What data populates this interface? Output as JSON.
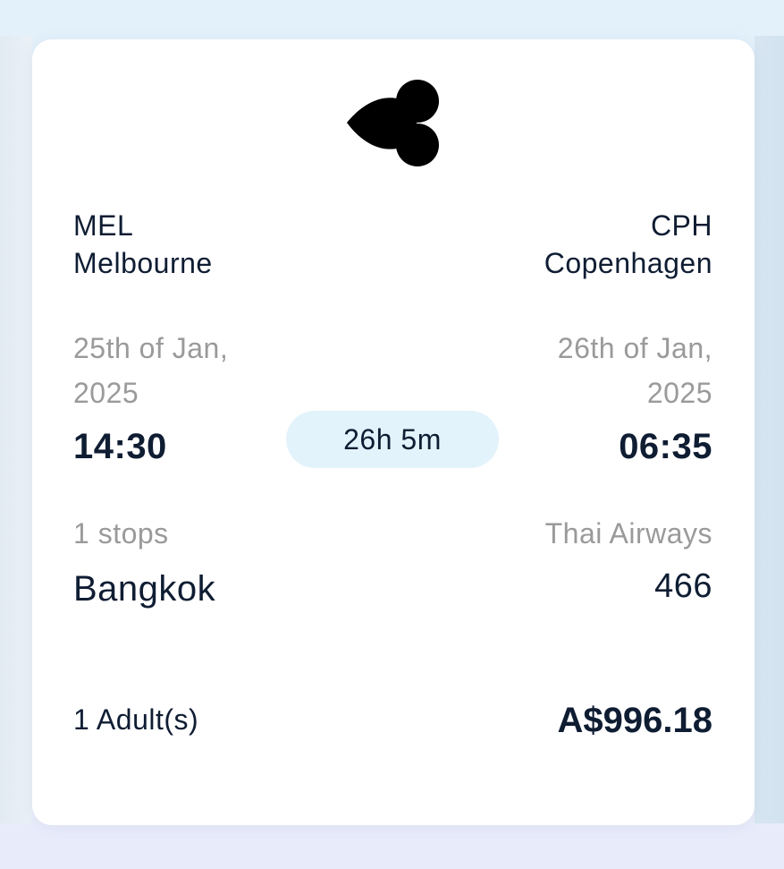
{
  "flight": {
    "origin": {
      "code": "MEL",
      "city": "Melbourne",
      "date_line1": "25th of Jan,",
      "date_line2": "2025",
      "time": "14:30"
    },
    "destination": {
      "code": "CPH",
      "city": "Copenhagen",
      "date_line1": "26th of Jan,",
      "date_line2": "2025",
      "time": "06:35"
    },
    "duration": "26h 5m",
    "stops_label": "1 stops",
    "stop_city": "Bangkok",
    "airline": "Thai Airways",
    "flight_number": "466",
    "passengers": "1 Adult(s)",
    "price": "A$996.18",
    "airline_logo_icon": "thai-airways-orchid-logo"
  }
}
